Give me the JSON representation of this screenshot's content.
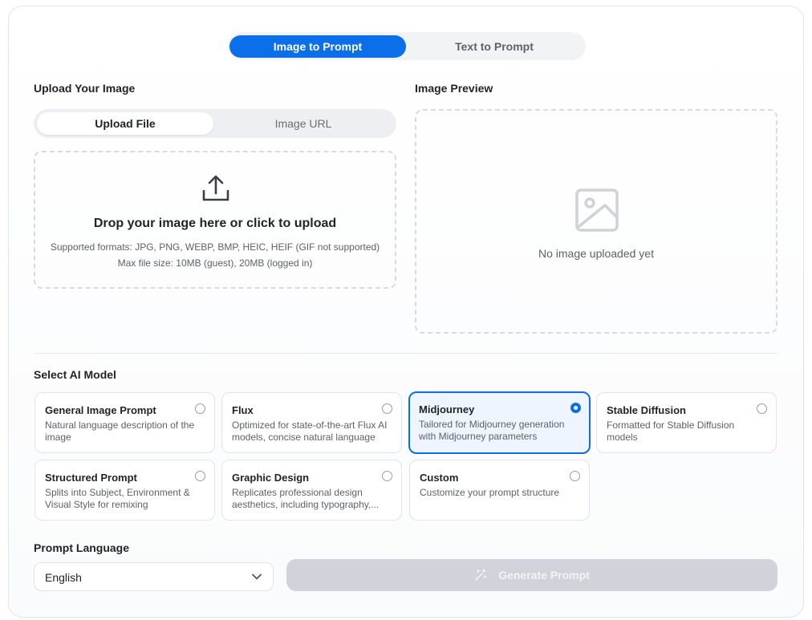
{
  "mode_tabs": [
    {
      "label": "Image to Prompt",
      "active": true
    },
    {
      "label": "Text to Prompt",
      "active": false
    }
  ],
  "upload": {
    "heading": "Upload Your Image",
    "tabs": [
      {
        "label": "Upload File",
        "active": true
      },
      {
        "label": "Image URL",
        "active": false
      }
    ],
    "dropzone": {
      "title": "Drop your image here or click to upload",
      "formats": "Supported formats: JPG, PNG, WEBP, BMP, HEIC, HEIF (GIF not supported)",
      "max_size": "Max file size: 10MB (guest), 20MB (logged in)",
      "icon": "upload-icon"
    }
  },
  "preview": {
    "heading": "Image Preview",
    "empty_text": "No image uploaded yet",
    "icon": "image-placeholder-icon"
  },
  "models": {
    "heading": "Select AI Model",
    "items": [
      {
        "name": "General Image Prompt",
        "desc": "Natural language description of the image",
        "selected": false
      },
      {
        "name": "Flux",
        "desc": "Optimized for state-of-the-art Flux AI models, concise natural language",
        "selected": false
      },
      {
        "name": "Midjourney",
        "desc": "Tailored for Midjourney generation with Midjourney parameters",
        "selected": true
      },
      {
        "name": "Stable Diffusion",
        "desc": "Formatted for Stable Diffusion models",
        "selected": false
      },
      {
        "name": "Structured Prompt",
        "desc": "Splits into Subject, Environment & Visual Style for remixing",
        "selected": false
      },
      {
        "name": "Graphic Design",
        "desc": "Replicates professional design aesthetics, including typography,...",
        "selected": false
      },
      {
        "name": "Custom",
        "desc": "Customize your prompt structure",
        "selected": false
      }
    ]
  },
  "language": {
    "heading": "Prompt Language",
    "selected": "English"
  },
  "generate": {
    "label": "Generate Prompt",
    "icon": "magic-wand-icon",
    "disabled": true
  },
  "colors": {
    "accent": "#0a6fe8",
    "selected_bg": "#eef5ff",
    "disabled_button": "#d0d3d9"
  }
}
